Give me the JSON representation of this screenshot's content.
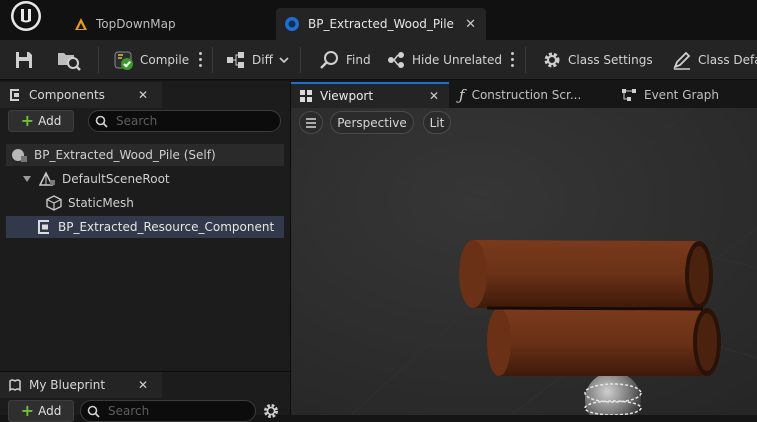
{
  "tabs": {
    "map": "TopDownMap",
    "blueprint": "BP_Extracted_Wood_Pile",
    "close": "✕"
  },
  "toolbar": {
    "compile": "Compile",
    "diff": "Diff",
    "find": "Find",
    "hide_unrelated": "Hide Unrelated",
    "class_settings": "Class Settings",
    "class_defaults": "Class Defa"
  },
  "components": {
    "title": "Components",
    "add": "Add",
    "search_placeholder": "Search",
    "tree": [
      "BP_Extracted_Wood_Pile (Self)",
      "DefaultSceneRoot",
      "StaticMesh",
      "BP_Extracted_Resource_Component"
    ]
  },
  "my_blueprint": {
    "title": "My Blueprint",
    "add": "Add",
    "search_placeholder": "Search"
  },
  "viewport": {
    "tabs": [
      "Viewport",
      "Construction Scr...",
      "Event Graph"
    ],
    "perspective": "Perspective",
    "lit": "Lit"
  },
  "colors": {
    "accent_blue": "#1f6fd1",
    "wood": "#6b3217",
    "selection": "#31394a"
  }
}
